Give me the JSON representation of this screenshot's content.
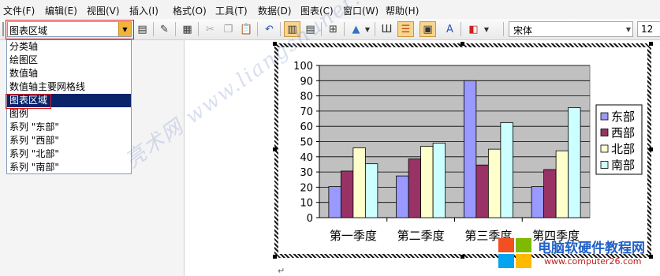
{
  "menu": [
    "文件(F)",
    "编辑(E)",
    "视图(V)",
    "插入(I)",
    "格式(O)",
    "工具(T)",
    "数据(D)",
    "图表(C)",
    "窗口(W)",
    "帮助(H)"
  ],
  "toolbar": {
    "chart_object_value": "图表区域",
    "font_name": "宋体",
    "font_size": "12"
  },
  "dropdown": {
    "options": [
      "分类轴",
      "绘图区",
      "数值轴",
      "数值轴主要网格线",
      "图表区域",
      "图例",
      "系列 \"东部\"",
      "系列 \"西部\"",
      "系列 \"北部\"",
      "系列 \"南部\""
    ],
    "selected_index": 4
  },
  "chart_data": {
    "type": "bar",
    "categories": [
      "第一季度",
      "第二季度",
      "第三季度",
      "第四季度"
    ],
    "series": [
      {
        "name": "东部",
        "values": [
          20.4,
          27.4,
          90,
          20.4
        ],
        "color": "#9999ff"
      },
      {
        "name": "西部",
        "values": [
          30.6,
          38.6,
          34.6,
          31.6
        ],
        "color": "#993366"
      },
      {
        "name": "北部",
        "values": [
          45.9,
          46.9,
          45,
          43.9
        ],
        "color": "#ffffcc"
      },
      {
        "name": "南部",
        "values": [
          35.4,
          49,
          62.5,
          72.3
        ],
        "color": "#ccffff"
      }
    ],
    "ylim": [
      0,
      100
    ],
    "yticks": [
      0,
      10,
      20,
      30,
      40,
      50,
      60,
      70,
      80,
      90,
      100
    ],
    "grid": true,
    "plot_background": "#c0c0c0",
    "legend": "right",
    "title": "",
    "xlabel": "",
    "ylabel": ""
  },
  "watermark": "亮术网 www.liangshunet.com",
  "logo": {
    "title": "电脑软硬件教程网",
    "url": "www.computer26.com"
  },
  "paragraph_mark": "↵"
}
